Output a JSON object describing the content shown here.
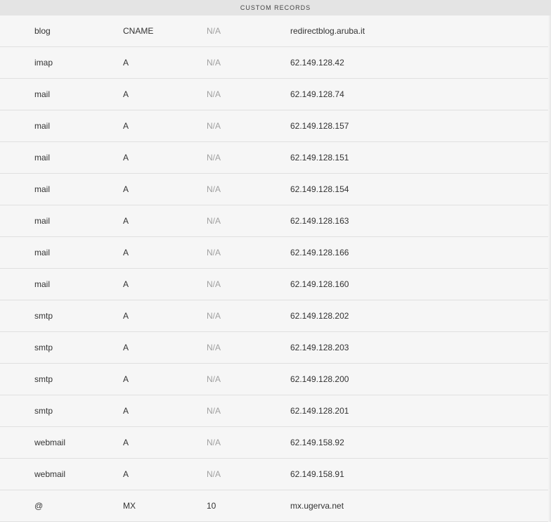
{
  "section_title": "CUSTOM RECORDS",
  "records": [
    {
      "name": "blog",
      "type": "CNAME",
      "priority": "N/A",
      "value": "redirectblog.aruba.it"
    },
    {
      "name": "imap",
      "type": "A",
      "priority": "N/A",
      "value": "62.149.128.42"
    },
    {
      "name": "mail",
      "type": "A",
      "priority": "N/A",
      "value": "62.149.128.74"
    },
    {
      "name": "mail",
      "type": "A",
      "priority": "N/A",
      "value": "62.149.128.157"
    },
    {
      "name": "mail",
      "type": "A",
      "priority": "N/A",
      "value": "62.149.128.151"
    },
    {
      "name": "mail",
      "type": "A",
      "priority": "N/A",
      "value": "62.149.128.154"
    },
    {
      "name": "mail",
      "type": "A",
      "priority": "N/A",
      "value": "62.149.128.163"
    },
    {
      "name": "mail",
      "type": "A",
      "priority": "N/A",
      "value": "62.149.128.166"
    },
    {
      "name": "mail",
      "type": "A",
      "priority": "N/A",
      "value": "62.149.128.160"
    },
    {
      "name": "smtp",
      "type": "A",
      "priority": "N/A",
      "value": "62.149.128.202"
    },
    {
      "name": "smtp",
      "type": "A",
      "priority": "N/A",
      "value": "62.149.128.203"
    },
    {
      "name": "smtp",
      "type": "A",
      "priority": "N/A",
      "value": "62.149.128.200"
    },
    {
      "name": "smtp",
      "type": "A",
      "priority": "N/A",
      "value": "62.149.128.201"
    },
    {
      "name": "webmail",
      "type": "A",
      "priority": "N/A",
      "value": "62.149.158.92"
    },
    {
      "name": "webmail",
      "type": "A",
      "priority": "N/A",
      "value": "62.149.158.91"
    },
    {
      "name": "@",
      "type": "MX",
      "priority": "10",
      "value": "mx.ugerva.net"
    }
  ]
}
